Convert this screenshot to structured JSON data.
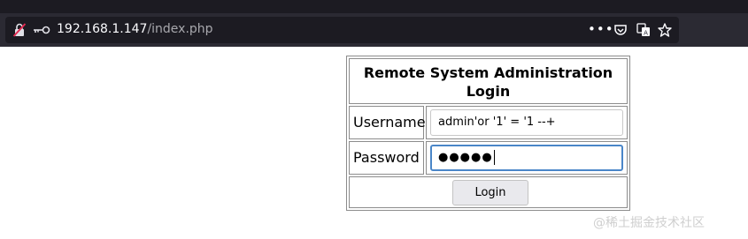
{
  "browser": {
    "url_host": "192.168.1.147",
    "url_path": "/index.php",
    "more_icon": "more-dots-icon",
    "pocket_icon": "pocket-icon",
    "translate_icon": "translate-icon",
    "bookmark_icon": "bookmark-star-icon"
  },
  "login": {
    "title_line1": "Remote System Administration",
    "title_line2": "Login",
    "username_label": "Username",
    "username_value": "admin'or '1' = '1 --+",
    "password_label": "Password",
    "password_masked": "●●●●●",
    "submit_label": "Login"
  },
  "watermark": "@稀土掘金技术社区"
}
